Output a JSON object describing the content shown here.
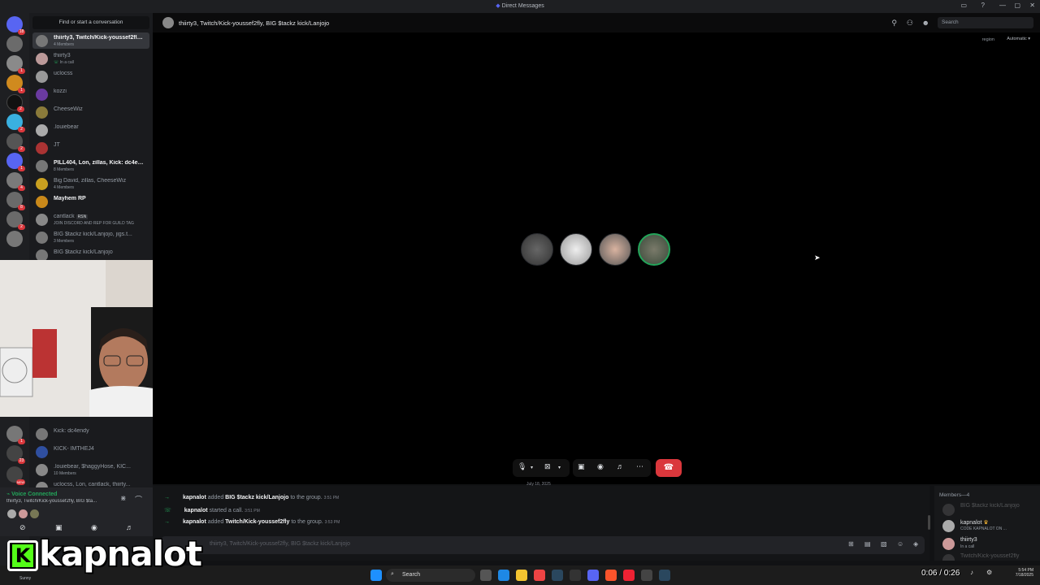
{
  "window": {
    "title": "Direct Messages"
  },
  "dm_sidebar": {
    "search_placeholder": "Find or start a conversation",
    "items": [
      {
        "name": "thiirty3, Twitch/Kick-youssef2fly, BIG $tackz kick/Lanjojo",
        "sub": "4 Members",
        "active": true,
        "bright": true
      },
      {
        "name": "thiirty3",
        "sub": "In a call"
      },
      {
        "name": "uclocss",
        "sub": ""
      },
      {
        "name": "kozzi",
        "sub": ""
      },
      {
        "name": "CheeseWiz",
        "sub": ""
      },
      {
        "name": ".louiebear",
        "sub": ""
      },
      {
        "name": "JT",
        "sub": ""
      },
      {
        "name": "PILL404, Lon, zillas, Kick: dc4endy",
        "sub": "8 Members",
        "bright": true
      },
      {
        "name": "Big David, zillas, CheeseWiz",
        "sub": "4 Members"
      },
      {
        "name": "Mayhem RP",
        "sub": "",
        "bright": true
      },
      {
        "name": "cantlack",
        "sub": "JOIN DISCORD AND REP FOR GUILD TAG"
      },
      {
        "name": "BIG $tackz kick/Lanjojo, jigs.t...",
        "sub": "3 Members"
      },
      {
        "name": "BIG $tackz kick/Lanjojo",
        "sub": ""
      },
      {
        "name": "Kick: dc4endy",
        "sub": ""
      },
      {
        "name": "KICK- IMTHEJ4",
        "sub": ""
      },
      {
        "name": ".louiebear, $haggyHose, KIC...",
        "sub": "10 Members"
      },
      {
        "name": "uclocss, Lon, cantlack, thiirty...",
        "sub": ""
      }
    ],
    "cantlack_tag": "RSN",
    "rail_badges": [
      "18",
      "",
      "1",
      "1",
      "2",
      "2",
      "2",
      "7",
      "1",
      "4",
      "8",
      "2",
      "",
      "1",
      "23",
      "NEW"
    ]
  },
  "voice": {
    "status": "Voice Connected",
    "channel": "thiirty3, Twitch/Kick-youssef2fly, BIG $ta..."
  },
  "header": {
    "group_title": "thiirty3, Twitch/Kick-youssef2fly, BIG $tackz kick/Lanjojo",
    "search_placeholder": "Search",
    "region_label": "region",
    "region_value": "Automatic"
  },
  "call": {
    "participants": [
      "thiirty3",
      "BIG $tackz kick/Lanjojo",
      "kapnalot",
      "Twitch/Kick-youssef2fly"
    ]
  },
  "chat": {
    "date_divider": "July 18, 2025",
    "messages": [
      {
        "user": "kapnalot",
        "action": "added",
        "target": "BIG $tackz kick/Lanjojo",
        "suffix": "to the group.",
        "time": "3:51 PM"
      },
      {
        "user": "kapnalot",
        "action": "started a call.",
        "target": "",
        "suffix": "",
        "time": "3:51 PM"
      },
      {
        "user": "kapnalot",
        "action": "added",
        "target": "Twitch/Kick-youssef2fly",
        "suffix": "to the group.",
        "time": "3:53 PM"
      }
    ],
    "composer_placeholder": "thiirty3, Twitch/Kick-youssef2fly, BIG $tackz kick/Lanjojo"
  },
  "members": {
    "header": "Members—4",
    "list": [
      {
        "name": "BIG $tackz kick/Lanjojo",
        "sub": "",
        "dim": true
      },
      {
        "name": "kapnalot",
        "sub": "CODE KAPNALOT ON ..."
      },
      {
        "name": "thiirty3",
        "sub": "In a call"
      },
      {
        "name": "Twitch/Kick-youssef2fly",
        "sub": "",
        "dim": true
      }
    ]
  },
  "taskbar": {
    "search_label": "Search",
    "time": "5:54 PM",
    "date": "7/18/2025"
  },
  "overlay": {
    "streamer": "kapnalot",
    "logo_letter": "K",
    "timecode": "0:06 / 0:26",
    "weather": "Sunny"
  },
  "colors": {
    "accent_green": "#23a55a",
    "hangup_red": "#da373c",
    "kick_green": "#53fc18",
    "discord_blurple": "#5865f2"
  }
}
